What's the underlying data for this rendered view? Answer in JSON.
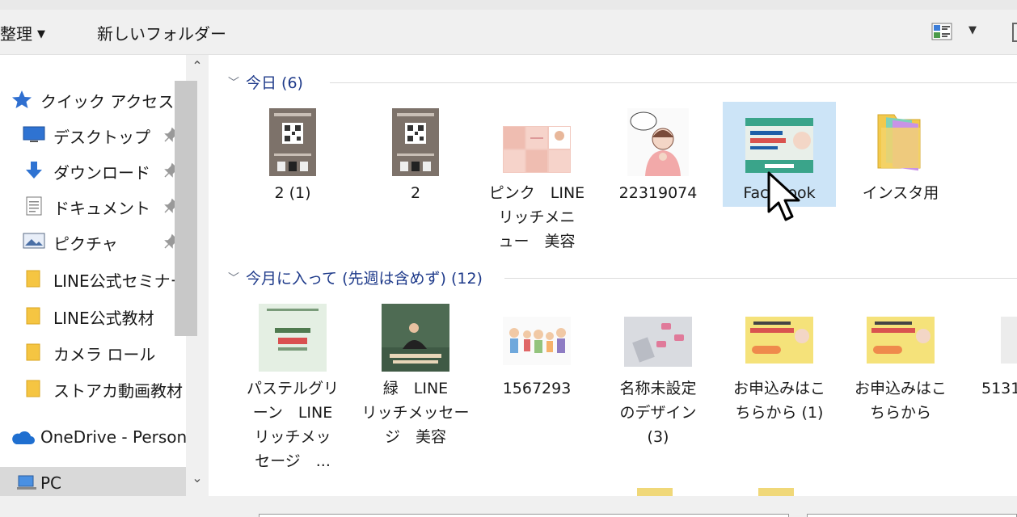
{
  "toolbar": {
    "organize_label": "整理",
    "new_folder_label": "新しいフォルダー"
  },
  "nav": {
    "items": [
      {
        "label": "クイック アクセス",
        "icon": "star-icon"
      },
      {
        "label": "デスクトップ",
        "icon": "desktop-icon",
        "pinned": true
      },
      {
        "label": "ダウンロード",
        "icon": "download-icon",
        "pinned": true
      },
      {
        "label": "ドキュメント",
        "icon": "document-icon",
        "pinned": true
      },
      {
        "label": "ピクチャ",
        "icon": "pictures-icon",
        "pinned": true
      },
      {
        "label": "LINE公式セミナー",
        "icon": "folder-icon"
      },
      {
        "label": "LINE公式教材",
        "icon": "folder-icon"
      },
      {
        "label": "カメラ ロール",
        "icon": "folder-icon"
      },
      {
        "label": "ストアカ動画教材",
        "icon": "folder-icon"
      },
      {
        "label": "OneDrive - Person",
        "icon": "cloud-icon"
      },
      {
        "label": "PC",
        "icon": "pc-icon"
      }
    ]
  },
  "groups": [
    {
      "header": "今日 (6)",
      "files": [
        {
          "name": "2 (1)",
          "thumb": "qr-flyer"
        },
        {
          "name": "2",
          "thumb": "qr-flyer"
        },
        {
          "name": "ピンク　LINE\nリッチメニ\nュー　美容",
          "thumb": "pink-grid"
        },
        {
          "name": "22319074",
          "thumb": "woman-illustration"
        },
        {
          "name": "Facebook",
          "thumb": "facebook-banner",
          "selected": true
        },
        {
          "name": "インスタ用",
          "thumb": "folder-thumb"
        }
      ]
    },
    {
      "header": "今月に入って (先週は含めず) (12)",
      "files": [
        {
          "name": "パステルグリ\nーン　LINE\nリッチメッ\nセージ　...",
          "thumb": "pastel-green"
        },
        {
          "name": "緑　LINE\nリッチメッセー\nジ　美容",
          "thumb": "yoga-photo"
        },
        {
          "name": "1567293",
          "thumb": "people-illustration"
        },
        {
          "name": "名称未設定\nのデザイン\n(3)",
          "thumb": "grey-design"
        },
        {
          "name": "お申込みはこ\nちらから (1)",
          "thumb": "yellow-banner"
        },
        {
          "name": "お申込みはこ\nちらから",
          "thumb": "yellow-banner"
        },
        {
          "name": "5131",
          "thumb": "partial"
        }
      ]
    }
  ]
}
